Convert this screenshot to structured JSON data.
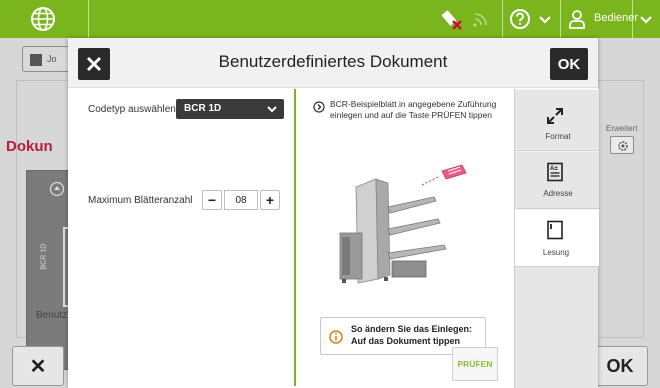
{
  "topbar": {
    "user_label": "Bediener",
    "icons": [
      "globe-icon",
      "no-signal-icon",
      "wifi-icon",
      "help-icon",
      "chevron-down-icon",
      "user-icon",
      "chevron-down-icon"
    ]
  },
  "background": {
    "title_fragment": "Dokun",
    "tab_extra": "Erweitert",
    "card_label": "Benutz",
    "card_vertical_label": "BCR 1D",
    "back_fragment": "Jo"
  },
  "dialog": {
    "title": "Benutzerdefiniertes Dokument",
    "ok_label": "OK",
    "codetype": {
      "label": "Codetyp auswählen",
      "value": "BCR 1D"
    },
    "max_sheets": {
      "label": "Maximum Blätteranzahl",
      "value": "08",
      "minus": "−",
      "plus": "+"
    },
    "instruction": "BCR-Beispielblatt in angegebene Zuführung einlegen und auf die Taste PRÜFEN tippen",
    "hint": {
      "line1": "So ändern Sie das Einlegen:",
      "line2": "Auf das Dokument tippen"
    },
    "check_button": "PRÜFEN",
    "tabs": [
      {
        "label": "Format",
        "icon": "expand-arrows-icon"
      },
      {
        "label": "Adresse",
        "icon": "address-document-icon"
      },
      {
        "label": "Lesung",
        "icon": "reading-document-icon"
      }
    ]
  },
  "colors": {
    "accent_green": "#7ab51d",
    "brand_red": "#b21f3b",
    "dark": "#2a2a2a"
  }
}
